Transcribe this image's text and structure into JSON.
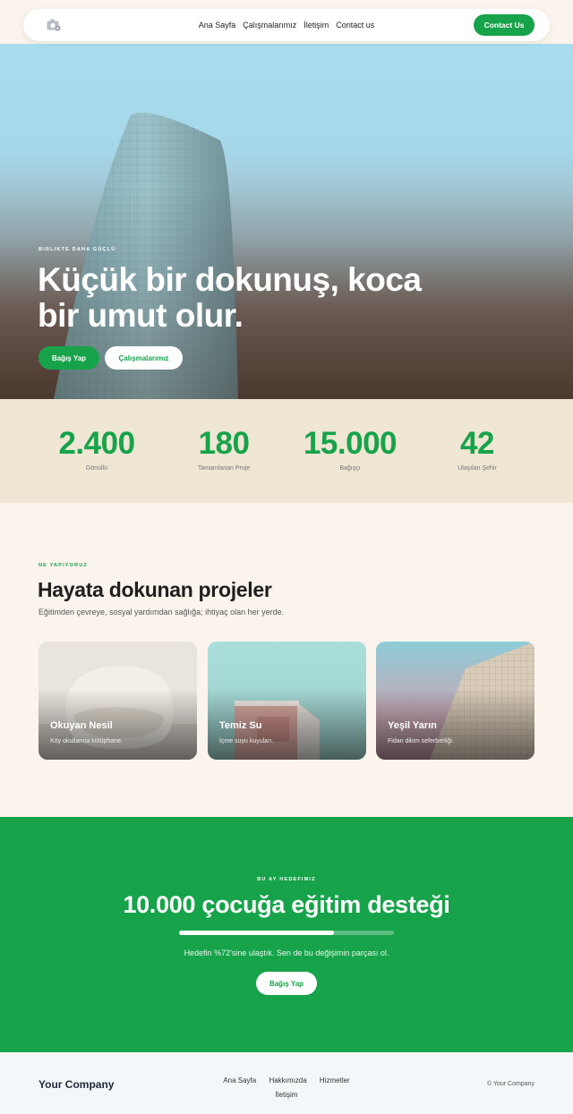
{
  "nav": {
    "links": [
      "Ana Sayfa",
      "Çalışmalarımız",
      "İletişim",
      "Contact us"
    ],
    "cta": "Contact Us",
    "logo_icon": "camera-icon"
  },
  "hero": {
    "eyebrow": "BIRLIKTE DAHA GÜÇLÜ",
    "title": "Küçük bir dokunuş, koca bir umut olur.",
    "primary_button": "Bağış Yap",
    "secondary_button": "Çalışmalarımız"
  },
  "stats": [
    {
      "value": "2.400",
      "label": "Gönüllü"
    },
    {
      "value": "180",
      "label": "Tamamlanan Proje"
    },
    {
      "value": "15.000",
      "label": "Bağışçı"
    },
    {
      "value": "42",
      "label": "Ulaşılan Şehir"
    }
  ],
  "projects": {
    "eyebrow": "NE YAPIYORUZ",
    "title": "Hayata dokunan projeler",
    "subtitle": "Eğitimden çevreye, sosyal yardımdan sağlığa; ihtiyaç olan her yerde.",
    "cards": [
      {
        "title": "Okuyan Nesil",
        "desc": "Köy okullarına kütüphane."
      },
      {
        "title": "Temiz Su",
        "desc": "İçme suyu kuyuları."
      },
      {
        "title": "Yeşil Yarın",
        "desc": "Fidan dikim seferberliği."
      }
    ]
  },
  "campaign": {
    "eyebrow": "BU AY HEDEFIMIZ",
    "title": "10.000 çocuğa eğitim desteği",
    "progress": 0.72,
    "note": "Hedefin %72'sine ulaştık. Sen de bu değişimin parçası ol.",
    "button": "Bağış Yap"
  },
  "footer": {
    "brand": "Your Company",
    "links": [
      "Ana Sayfa",
      "Hakkımızda",
      "Hizmetler",
      "İletişim"
    ],
    "copyright": "© Your Company"
  },
  "colors": {
    "accent": "#17a34a",
    "stats_bg": "#efe6d4",
    "page_bg": "#faf4ec"
  }
}
